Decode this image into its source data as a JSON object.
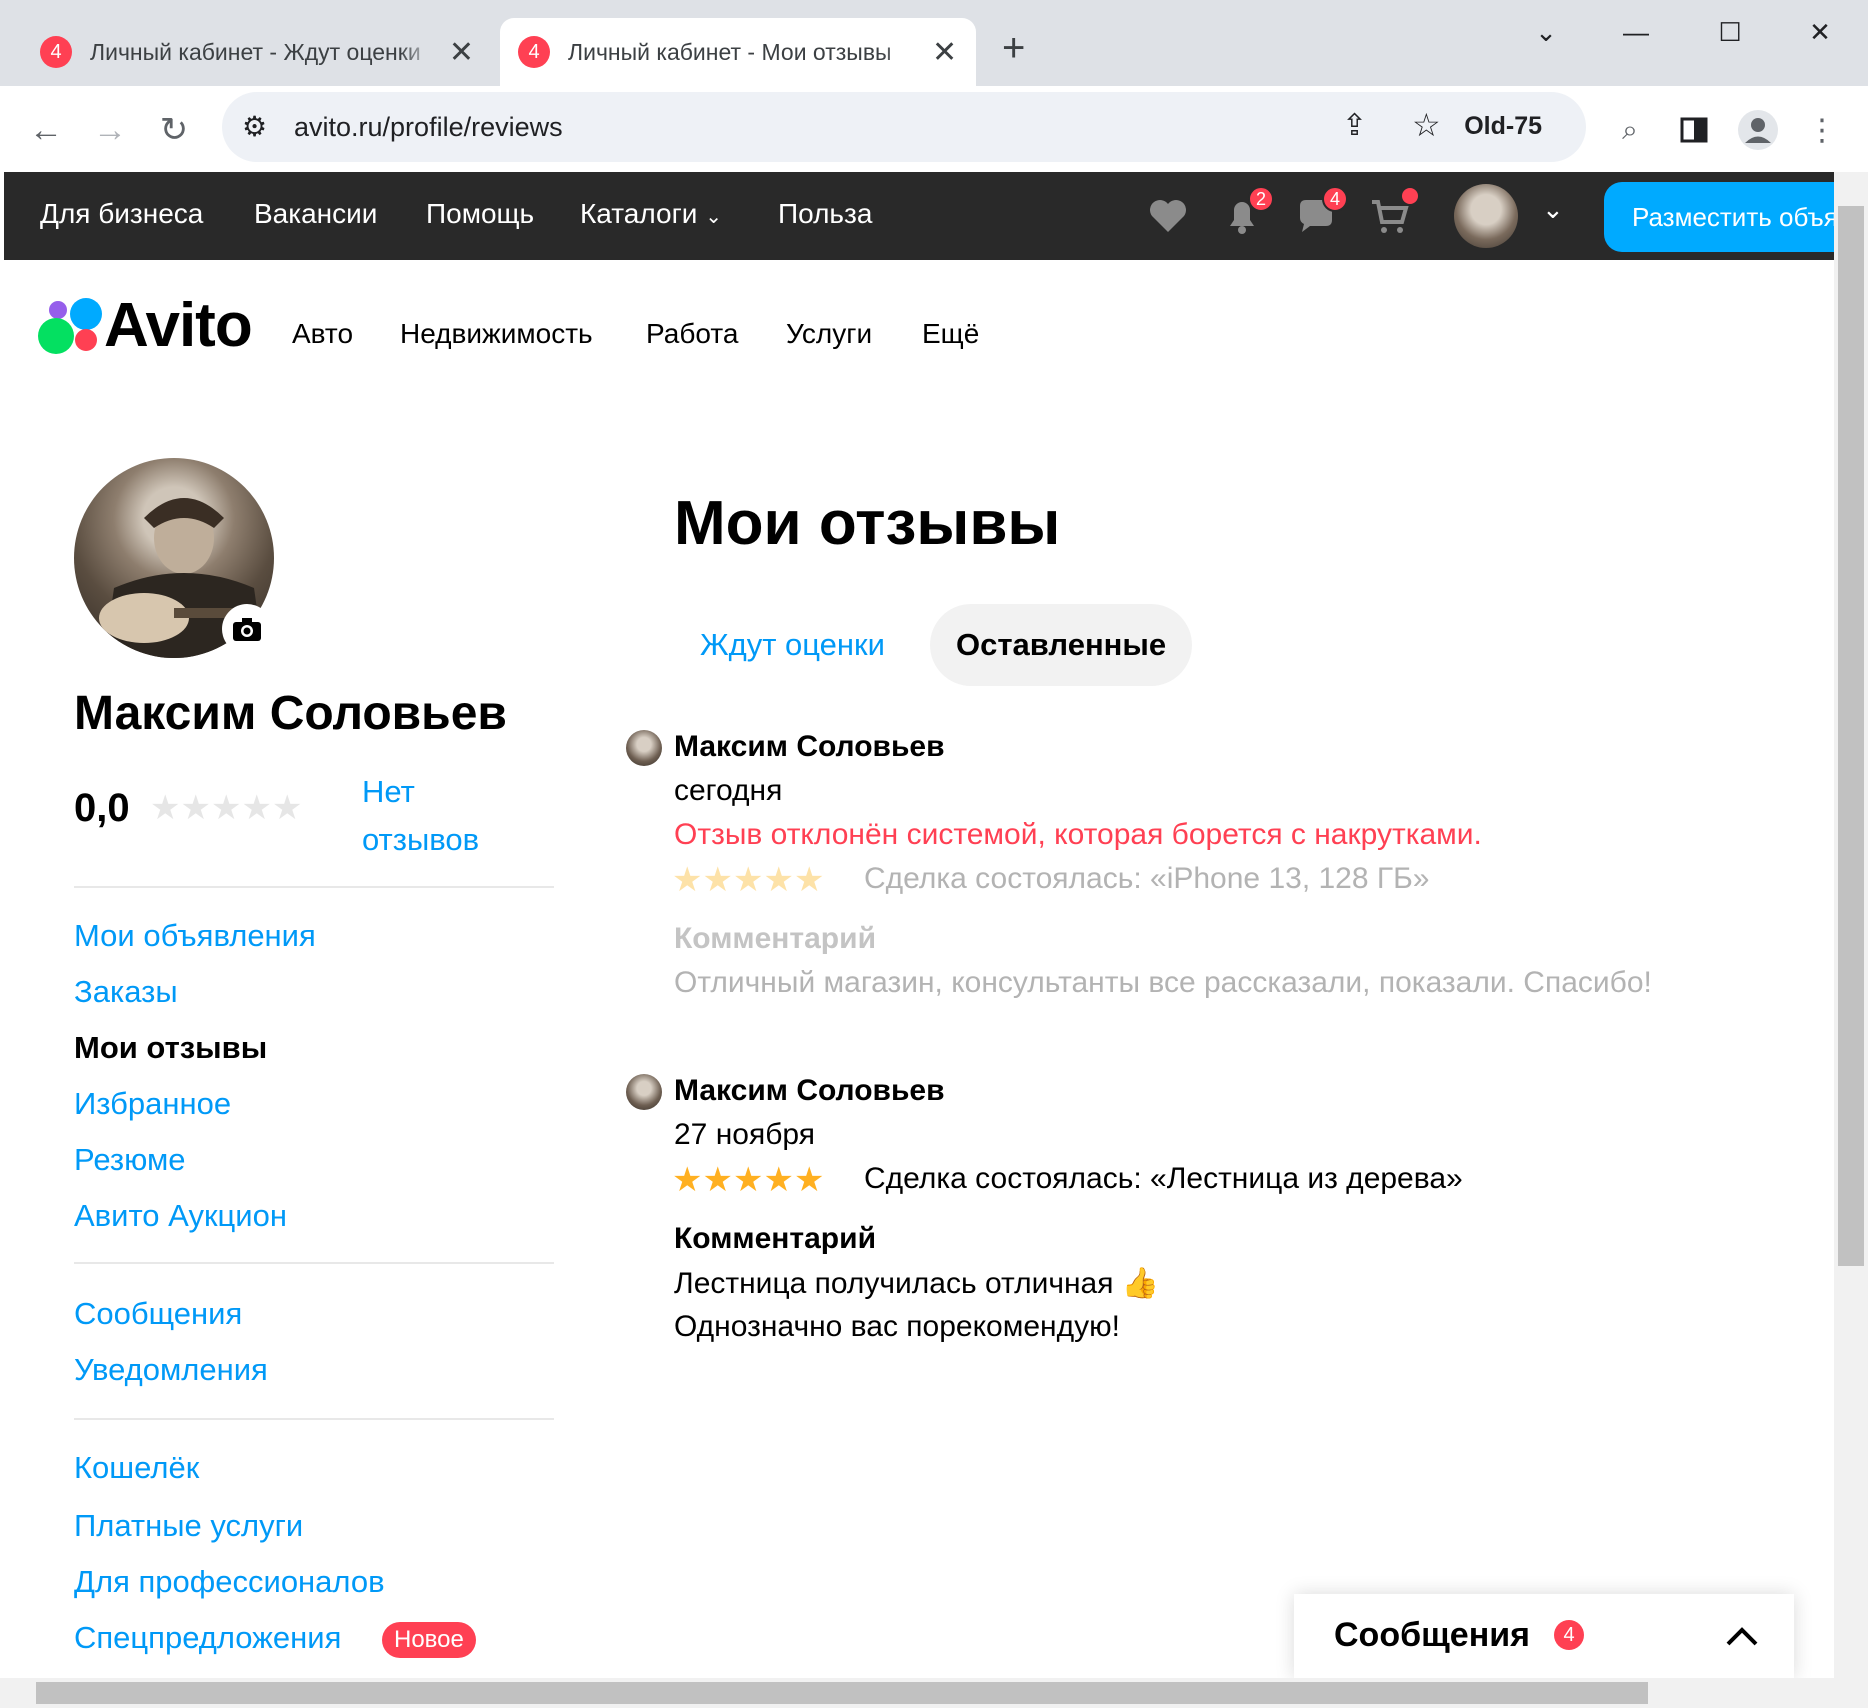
{
  "browser": {
    "tabs": [
      {
        "badge": "4",
        "title": "Личный кабинет - Ждут оценки"
      },
      {
        "badge": "4",
        "title": "Личный кабинет - Мои отзывы"
      }
    ],
    "new_tab": "+",
    "url": "avito.ru/profile/reviews",
    "profile_name": "Old-75"
  },
  "topbar": {
    "links": [
      "Для бизнеса",
      "Вакансии",
      "Помощь",
      "Каталоги",
      "Польза"
    ],
    "notifications_count": "2",
    "messages_count": "4",
    "post_button": "Разместить объявление"
  },
  "logo": "Avito",
  "categories": [
    "Авто",
    "Недвижимость",
    "Работа",
    "Услуги",
    "Ещё"
  ],
  "profile": {
    "name": "Максим Соловьев",
    "rating": "0,0",
    "reviews_text_1": "Нет",
    "reviews_text_2": "отзывов"
  },
  "sidebar": {
    "group1": [
      "Мои объявления",
      "Заказы",
      "Мои отзывы",
      "Избранное",
      "Резюме",
      "Авито Аукцион"
    ],
    "group2": [
      "Сообщения",
      "Уведомления"
    ],
    "group3": [
      "Кошелёк",
      "Платные услуги",
      "Для профессионалов",
      "Спецпредложения"
    ],
    "new_badge": "Новое"
  },
  "main": {
    "title": "Мои отзывы",
    "tabs": [
      "Ждут оценки",
      "Оставленные"
    ],
    "reviews": [
      {
        "author": "Максим Соловьев",
        "date": "сегодня",
        "rejected": "Отзыв отклонён системой, которая борется с накрутками.",
        "rating": 5,
        "deal": "Сделка состоялась: «iPhone 13, 128 ГБ»",
        "comment_label": "Комментарий",
        "comment": "Отличный магазин, консультанты все рассказали, показали. Спасибо!"
      },
      {
        "author": "Максим Соловьев",
        "date": "27 ноября",
        "rating": 5,
        "deal": "Сделка состоялась: «Лестница из дерева»",
        "comment_label": "Комментарий",
        "comment_line1": "Лестница получилась отличная 👍",
        "comment_line2": "Однозначно вас порекомендую!"
      }
    ]
  },
  "messages_widget": {
    "label": "Сообщения",
    "count": "4"
  },
  "colors": {
    "accent": "#0099f7",
    "brand_blue": "#00aaff",
    "badge_red": "#ff4053",
    "star": "#ffb021",
    "error": "#ff4053"
  }
}
